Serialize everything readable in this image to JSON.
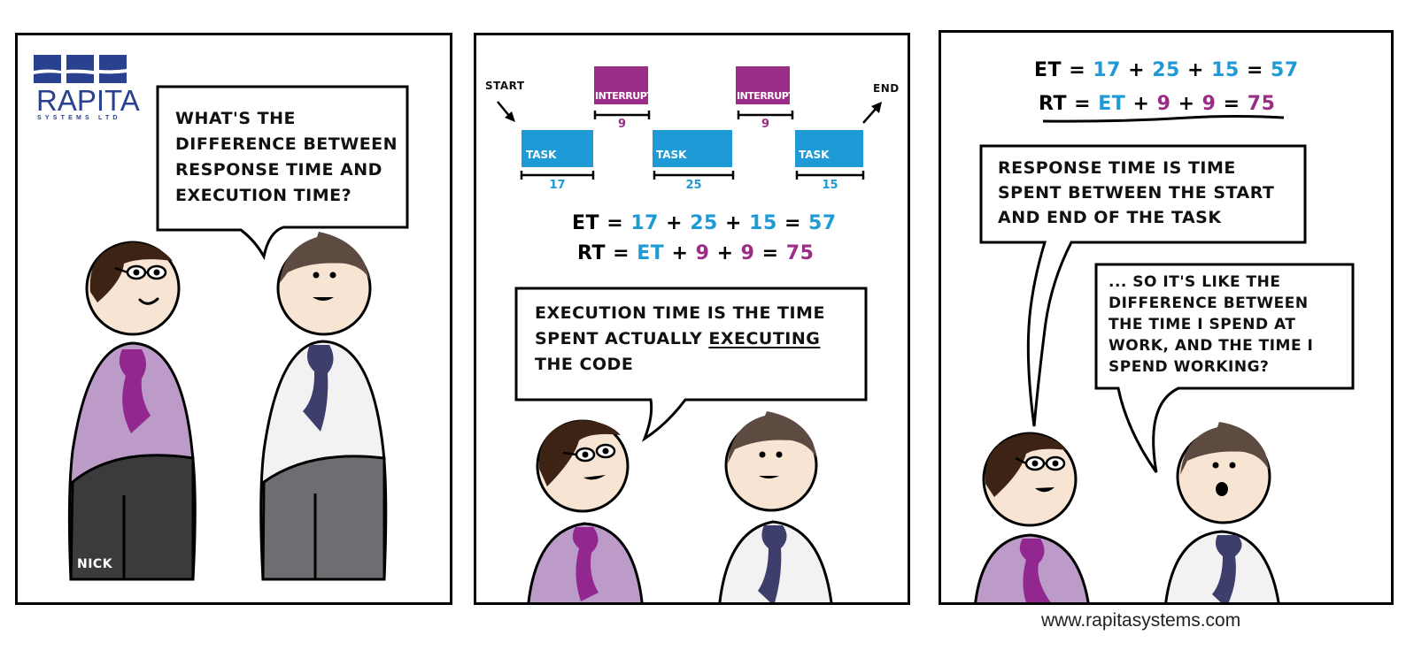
{
  "logo": {
    "name": "RAPITA",
    "subtitle": "SYSTEMS LTD",
    "color": "#29418f"
  },
  "colors": {
    "task": "#1e9ad6",
    "interrupt": "#9b2d87",
    "nick_shirt": "#bc9bc9",
    "nick_tie": "#92278f",
    "other_shirt": "#f2f2f2",
    "other_tie": "#3d3e6c",
    "skin": "#f7e4d2",
    "nick_hair": "#3d2314",
    "other_hair": "#5d4a40"
  },
  "panel1": {
    "speech": [
      "What's the",
      "difference between",
      "response time and",
      "execution time?"
    ],
    "name_tag": "NICK"
  },
  "panel2": {
    "timeline": {
      "start_label": "START",
      "end_label": "END",
      "tasks": [
        {
          "label": "TASK",
          "duration": "17"
        },
        {
          "label": "TASK",
          "duration": "25"
        },
        {
          "label": "TASK",
          "duration": "15"
        }
      ],
      "interrupts": [
        {
          "label": "INTERRUPT",
          "duration": "9"
        },
        {
          "label": "INTERRUPT",
          "duration": "9"
        }
      ]
    },
    "equations": {
      "et": {
        "lhs": "ET",
        "eq": "=",
        "terms": [
          "17",
          "25",
          "15"
        ],
        "plus": "+",
        "result": "57"
      },
      "rt": {
        "lhs": "RT",
        "eq": "=",
        "terms": [
          "ET",
          "9",
          "9"
        ],
        "plus": "+",
        "result": "75"
      }
    },
    "speech": {
      "line1": "Execution time is the time",
      "line2_pre": "spent actually ",
      "line2_emph": "executing",
      "line3": "the code"
    }
  },
  "panel3": {
    "speech_a": [
      "Response time is time",
      "spent between the start",
      "and end of the task"
    ],
    "speech_b": [
      "... so it's like the",
      "difference between",
      "the time I spend at",
      "work, and the time I",
      "spend working?"
    ]
  },
  "footer": {
    "url": "www.rapitasystems.com"
  }
}
